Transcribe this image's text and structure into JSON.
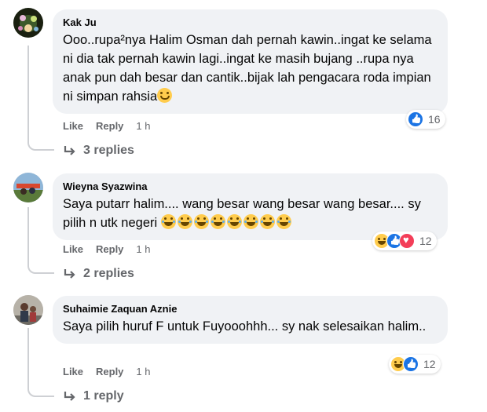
{
  "comments": [
    {
      "author": "Kak Ju",
      "text": "Ooo..rupa²nya Halim Osman dah pernah kawin..ingat ke selama ni dia tak pernah kawin lagi..ingat ke masih bujang ..rupa nya anak pun dah besar dan cantik..bijak lah pengacara roda impian ni simpan rahsia",
      "emoji": "smiling-face-icon",
      "like_label": "Like",
      "reply_label": "Reply",
      "time": "1 h",
      "reaction_count": "16",
      "replies_label": "3 replies"
    },
    {
      "author": "Wieyna Syazwina",
      "text": "Saya putarr halim.... wang besar wang besar wang besar.... sy pilih n utk negeri",
      "emoji_repeat": 8,
      "emoji": "tears-of-joy-icon",
      "like_label": "Like",
      "reply_label": "Reply",
      "time": "1 h",
      "reaction_count": "12",
      "replies_label": "2 replies"
    },
    {
      "author": "Suhaimie Zaquan Aznie",
      "text": "Saya pilih huruf F untuk Fuyooohhh... sy nak selesaikan halim..",
      "like_label": "Like",
      "reply_label": "Reply",
      "time": "1 h",
      "reaction_count": "12",
      "replies_label": "1 reply"
    }
  ],
  "colors": {
    "bubble": "#f0f2f5",
    "secondary_text": "#65676b",
    "like_blue": "#1b74e4",
    "love_red": "#f33e58",
    "haha_yellow": "#ffcc4d"
  }
}
